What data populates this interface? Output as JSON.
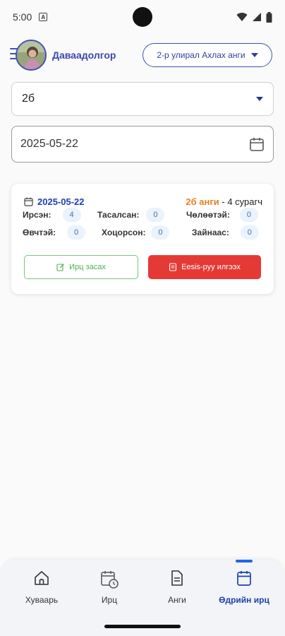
{
  "status": {
    "time": "5:00"
  },
  "header": {
    "user_name": "Даваадолгор",
    "semester": "2-р улирал Ахлах анги"
  },
  "filters": {
    "class_value": "2б",
    "date_value": "2025-05-22"
  },
  "card": {
    "date": "2025-05-22",
    "class_label": "2б анги",
    "students_label": "- 4 сурагч",
    "stats": [
      {
        "label": "Ирсэн:",
        "value": "4"
      },
      {
        "label": "Тасалсан:",
        "value": "0"
      },
      {
        "label": "Чөлөөтэй:",
        "value": "0"
      },
      {
        "label": "Өвчтэй:",
        "value": "0"
      },
      {
        "label": "Хоцорсон:",
        "value": "0"
      },
      {
        "label": "Зайнаас:",
        "value": "0"
      }
    ],
    "edit_button": "Ирц засах",
    "send_button": "Eesis-руу илгээх"
  },
  "nav": {
    "items": [
      {
        "label": "Хуваарь",
        "icon": "home-icon"
      },
      {
        "label": "Ирц",
        "icon": "calendar-clock-icon"
      },
      {
        "label": "Анги",
        "icon": "document-icon"
      },
      {
        "label": "Өдрийн ирц",
        "icon": "calendar-icon"
      }
    ],
    "active_index": 3
  },
  "colors": {
    "primary": "#3f51b5",
    "date_blue": "#1e40af",
    "class_orange": "#e67e22",
    "send_red": "#e53935",
    "edit_green": "#4caf50"
  }
}
